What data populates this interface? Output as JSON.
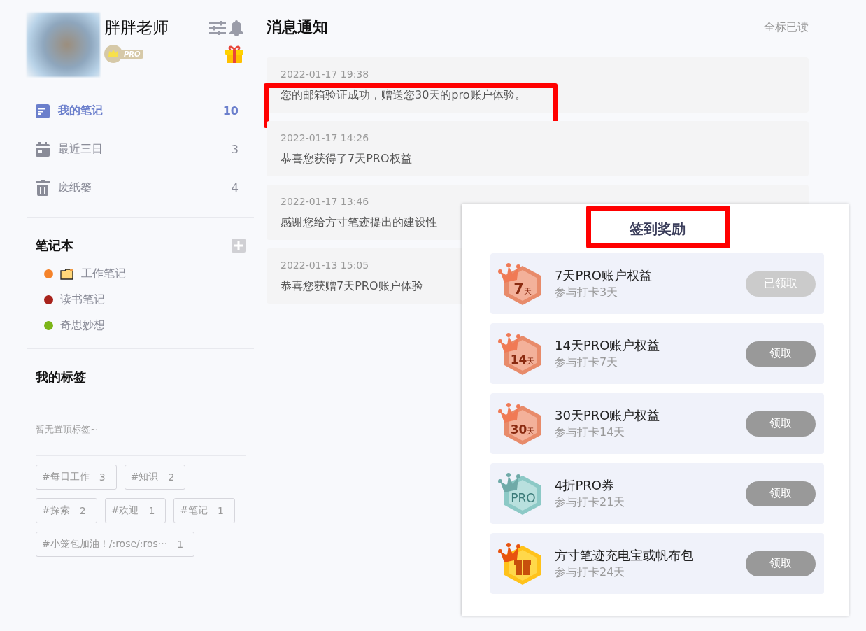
{
  "profile": {
    "name": "胖胖老师",
    "badge": "PRO"
  },
  "nav": [
    {
      "label": "我的笔记",
      "count": "10",
      "selected": true,
      "kind": "notes"
    },
    {
      "label": "最近三日",
      "count": "3",
      "selected": false,
      "kind": "calendar"
    },
    {
      "label": "废纸篓",
      "count": "4",
      "selected": false,
      "kind": "trash"
    }
  ],
  "notebooks": {
    "title": "笔记本",
    "items": [
      {
        "label": "工作笔记",
        "color": "#f5832a",
        "kind": "folder"
      },
      {
        "label": "读书笔记",
        "color": "#a8231c",
        "kind": "plain"
      },
      {
        "label": "奇思妙想",
        "color": "#7cb518",
        "kind": "plain"
      }
    ]
  },
  "tags": {
    "title": "我的标签",
    "empty_hint": "暂无置顶标签~",
    "items": [
      {
        "label": "#每日工作",
        "count": "3"
      },
      {
        "label": "#知识",
        "count": "2"
      },
      {
        "label": "#探索",
        "count": "2"
      },
      {
        "label": "#欢迎",
        "count": "1"
      },
      {
        "label": "#笔记",
        "count": "1"
      },
      {
        "label": "#小笼包加油！/:rose/:ros···",
        "count": "1"
      }
    ]
  },
  "main": {
    "title": "消息通知",
    "mark_all_read": "全标已读",
    "messages": [
      {
        "time": "2022-01-17 19:38",
        "text": "您的邮箱验证成功，赠送您30天的pro账户体验。",
        "highlighted": true
      },
      {
        "time": "2022-01-17 14:26",
        "text": "恭喜您获得了7天PRO权益",
        "highlighted": false
      },
      {
        "time": "2022-01-17 13:46",
        "text": "感谢您给方寸笔迹提出的建设性",
        "highlighted": false
      },
      {
        "time": "2022-01-13 15:05",
        "text": "恭喜您获赠7天PRO账户体验",
        "highlighted": false
      }
    ]
  },
  "rewards_popup": {
    "title": "签到奖励",
    "title_highlighted": true,
    "items": [
      {
        "kind": "days",
        "badge_number": "7",
        "badge_unit": "天",
        "title": "7天PRO账户权益",
        "subtitle": "参与打卡3天",
        "button": "已领取",
        "claimed": true
      },
      {
        "kind": "days",
        "badge_number": "14",
        "badge_unit": "天",
        "title": "14天PRO账户权益",
        "subtitle": "参与打卡7天",
        "button": "领取",
        "claimed": false
      },
      {
        "kind": "days",
        "badge_number": "30",
        "badge_unit": "天",
        "title": "30天PRO账户权益",
        "subtitle": "参与打卡14天",
        "button": "领取",
        "claimed": false
      },
      {
        "kind": "pro",
        "badge_number": "PRO",
        "title": "4折PRO券",
        "subtitle": "参与打卡21天",
        "button": "领取",
        "claimed": false
      },
      {
        "kind": "gift",
        "title": "方寸笔迹充电宝或帆布包",
        "subtitle": "参与打卡24天",
        "button": "领取",
        "claimed": false
      }
    ]
  }
}
